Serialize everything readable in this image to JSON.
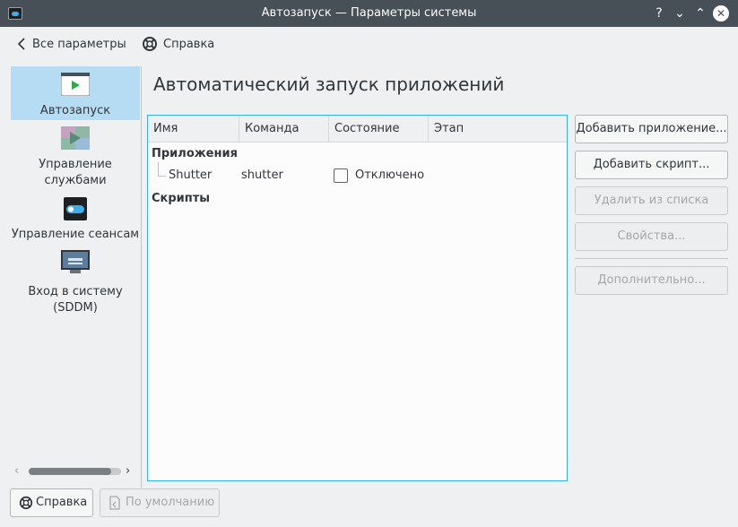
{
  "window": {
    "title": "Автозапуск  — Параметры системы",
    "help_glyph": "?",
    "minimize_glyph": "⌄",
    "maximize_glyph": "⌃",
    "close_glyph": "✕"
  },
  "nav": {
    "back_label": "Все параметры",
    "help_label": "Справка"
  },
  "sidebar": {
    "items": [
      {
        "label": "Автозапуск",
        "icon": "autostart-icon",
        "active": true
      },
      {
        "label": "Управление службами",
        "icon": "services-icon",
        "active": false
      },
      {
        "label": "Управление сеансам",
        "icon": "session-toggle-icon",
        "active": false
      },
      {
        "label": "Вход в систему (SDDM)",
        "icon": "login-screen-icon",
        "active": false
      }
    ]
  },
  "page": {
    "title": "Автоматический запуск приложений"
  },
  "table": {
    "columns": [
      "Имя",
      "Команда",
      "Состояние",
      "Этап"
    ],
    "groups": [
      {
        "label": "Приложения",
        "rows": [
          {
            "name": "Shutter",
            "command": "shutter",
            "state": "Отключено",
            "checked": false,
            "stage": ""
          }
        ]
      },
      {
        "label": "Скрипты",
        "rows": []
      }
    ]
  },
  "actions": {
    "add_app": "Добавить приложение...",
    "add_script": "Добавить скрипт...",
    "remove": "Удалить из списка",
    "properties": "Свойства...",
    "advanced": "Дополнительно..."
  },
  "footer": {
    "help": "Справка",
    "defaults": "По умолчанию"
  },
  "colors": {
    "accent": "#3daee9",
    "selection": "#b6dcf3",
    "titlebar": "#475057",
    "window_bg": "#eff0f1"
  }
}
